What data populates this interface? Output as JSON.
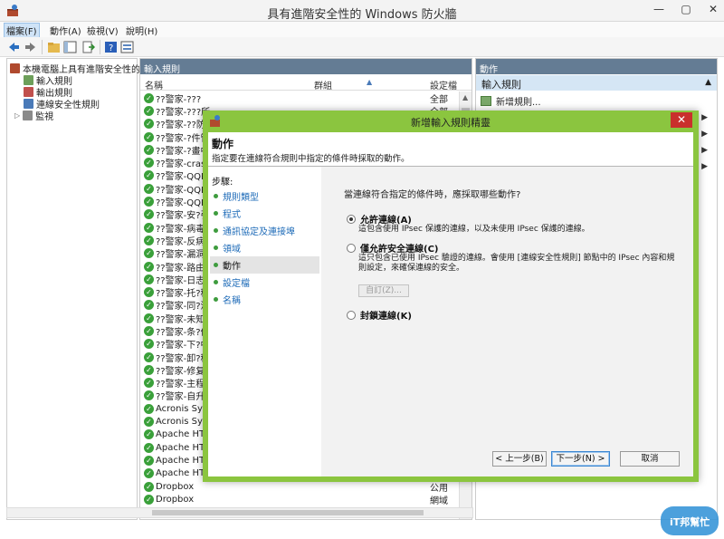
{
  "window": {
    "title": "具有進階安全性的 Windows 防火牆",
    "controls": [
      "—",
      "▢",
      "✕"
    ]
  },
  "menu": [
    "檔案(F)",
    "動作(A)",
    "檢視(V)",
    "說明(H)"
  ],
  "tree": {
    "root": "本機電腦上具有進階安全性的 W",
    "items": [
      "輸入規則",
      "輸出規則",
      "連線安全性規則",
      "監視"
    ]
  },
  "center": {
    "header": "輸入規則",
    "columns": {
      "name": "名稱",
      "group": "群組",
      "profile": "設定檔"
    },
    "rows": [
      {
        "name": "??警家-???",
        "profile": "全部"
      },
      {
        "name": "??警家-???所",
        "profile": "全部"
      },
      {
        "name": "??警家-??防?",
        "profile": ""
      },
      {
        "name": "??警家-?件管",
        "profile": ""
      },
      {
        "name": "??警家-?畫中",
        "profile": ""
      },
      {
        "name": "??警家-crash",
        "profile": ""
      },
      {
        "name": "??警家-QQP(",
        "profile": ""
      },
      {
        "name": "??警家-QQP(",
        "profile": ""
      },
      {
        "name": "??警家-QQP(",
        "profile": ""
      },
      {
        "name": "??警家-安?引",
        "profile": ""
      },
      {
        "name": "??警家-病毒?",
        "profile": ""
      },
      {
        "name": "??警家-反病毒",
        "profile": ""
      },
      {
        "name": "??警家-漏洞?",
        "profile": ""
      },
      {
        "name": "??警家-路由器",
        "profile": ""
      },
      {
        "name": "??警家-日志上",
        "profile": ""
      },
      {
        "name": "??警家-托?程",
        "profile": ""
      },
      {
        "name": "??警家-同?流",
        "profile": ""
      },
      {
        "name": "??警家-未知文",
        "profile": ""
      },
      {
        "name": "??警家-条?优",
        "profile": ""
      },
      {
        "name": "??警家-下?中",
        "profile": ""
      },
      {
        "name": "??警家-卸?程",
        "profile": ""
      },
      {
        "name": "??警家-修复器",
        "profile": ""
      },
      {
        "name": "??警家-主程序",
        "profile": ""
      },
      {
        "name": "??警家-自升?",
        "profile": ""
      },
      {
        "name": "Acronis Sync",
        "profile": ""
      },
      {
        "name": "Acronis Sync",
        "profile": ""
      },
      {
        "name": "Apache HTTI",
        "profile": ""
      },
      {
        "name": "Apache HTTI",
        "profile": ""
      },
      {
        "name": "Apache HTTI",
        "profile": ""
      },
      {
        "name": "Apache HTTI",
        "profile": ""
      },
      {
        "name": "Dropbox",
        "profile": "公用"
      },
      {
        "name": "Dropbox",
        "profile": "網域"
      }
    ]
  },
  "actions": {
    "header": "動作",
    "section": "輸入規則",
    "items": [
      "新增規則..."
    ]
  },
  "dialog": {
    "title": "新增輸入規則精靈",
    "heading": "動作",
    "subheading": "指定要在連線符合規則中指定的條件時採取的動作。",
    "steps_title": "步驟:",
    "steps": [
      "規則類型",
      "程式",
      "通訊協定及連接埠",
      "領域",
      "動作",
      "設定檔",
      "名稱"
    ],
    "current_step": 4,
    "question": "當連線符合指定的條件時，應採取哪些動作?",
    "options": [
      {
        "label": "允許連線(A)",
        "desc": "這包含使用 IPsec 保護的連線，以及未使用 IPsec 保護的連線。",
        "selected": true
      },
      {
        "label": "僅允許安全連線(C)",
        "desc": "這只包含已使用 IPsec 驗證的連線。會使用 [連線安全性規則] 節點中的 IPsec 內容和規則設定，來確保連線的安全。",
        "selected": false
      },
      {
        "label": "封鎖連線(K)",
        "desc": "",
        "selected": false
      }
    ],
    "customize_label": "自訂(Z)...",
    "buttons": {
      "back": "< 上一步(B)",
      "next": "下一步(N) >",
      "cancel": "取消"
    }
  },
  "watermark": "iT邦幫忙",
  "colors": {
    "dialog_frame": "#8bc53f",
    "panel_header": "#647c94",
    "close_red": "#c9302c",
    "link_blue": "#1e6bb8"
  }
}
